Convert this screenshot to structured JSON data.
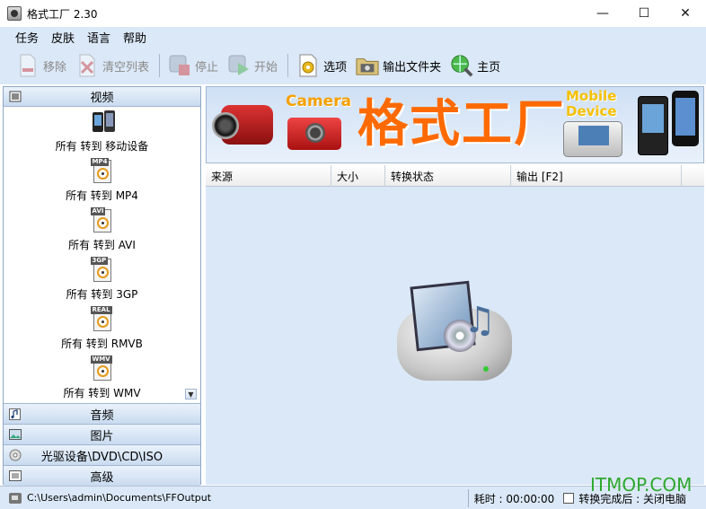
{
  "window": {
    "title": "格式工厂 2.30",
    "controls": {
      "minimize": "—",
      "maximize": "☐",
      "close": "✕"
    }
  },
  "menu": [
    "任务",
    "皮肤",
    "语言",
    "帮助"
  ],
  "toolbar": {
    "remove": "移除",
    "clear": "清空列表",
    "stop": "停止",
    "start": "开始",
    "options": "选项",
    "output_folder": "输出文件夹",
    "home": "主页"
  },
  "sidebar": {
    "video_header": "视频",
    "video_items": [
      "所有 转到 移动设备",
      "所有 转到 MP4",
      "所有 转到 AVI",
      "所有 转到 3GP",
      "所有 转到 RMVB",
      "所有 转到 WMV"
    ],
    "format_tags": [
      "",
      "MP4",
      "AVI",
      "3GP",
      "REAL",
      "WMV"
    ],
    "categories": [
      "音频",
      "图片",
      "光驱设备\\DVD\\CD\\ISO",
      "高级"
    ]
  },
  "banner": {
    "camera_word": "Camera",
    "title": "格式工厂",
    "mobile_line1": "Mobile",
    "mobile_line2": "Device"
  },
  "table": {
    "columns": [
      "来源",
      "大小",
      "转换状态",
      "输出 [F2]"
    ]
  },
  "status": {
    "output_path": "C:\\Users\\admin\\Documents\\FFOutput",
    "elapsed": "耗时 : 00:00:00",
    "after_done": "转换完成后 : 关闭电脑"
  },
  "watermark": "ITMOP.COM",
  "colors": {
    "background": "#dbe8f7",
    "banner_title": "#ff6a00",
    "accent_orange": "#f6a000",
    "watermark": "#2ea82e"
  }
}
